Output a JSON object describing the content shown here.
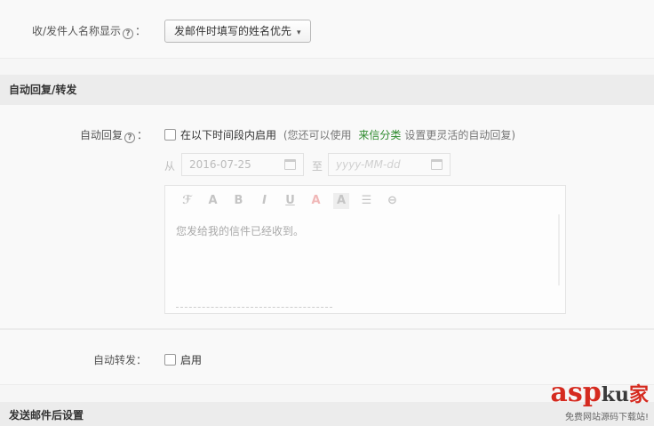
{
  "sender_display": {
    "label": "收/发件人名称显示",
    "help": "?",
    "colon": "：",
    "selected": "发邮件时填写的姓名优先"
  },
  "auto_section": {
    "title": "自动回复/转发"
  },
  "auto_reply": {
    "label": "自动回复",
    "help": "?",
    "colon": "：",
    "enable_text": "在以下时间段内启用",
    "hint_prefix": "(您还可以使用",
    "hint_link": "来信分类",
    "hint_suffix": "设置更灵活的自动回复)",
    "from_label": "从",
    "from_date": "2016-07-25",
    "to_label": "至",
    "to_placeholder": "yyyy-MM-dd",
    "toolbar": [
      "ℱ",
      "A",
      "B",
      "I",
      "U",
      "A",
      "A",
      "☰",
      "⊖"
    ],
    "body_text": "您发给我的信件已经收到。"
  },
  "auto_forward": {
    "label": "自动转发",
    "colon": "：",
    "enable_text": "启用"
  },
  "after_send_section": {
    "title": "发送邮件后设置"
  },
  "watermark": {
    "brand": "asp",
    "brand2": "ku",
    "brand3": "家",
    "sub": "免费网站源码下载站!"
  }
}
